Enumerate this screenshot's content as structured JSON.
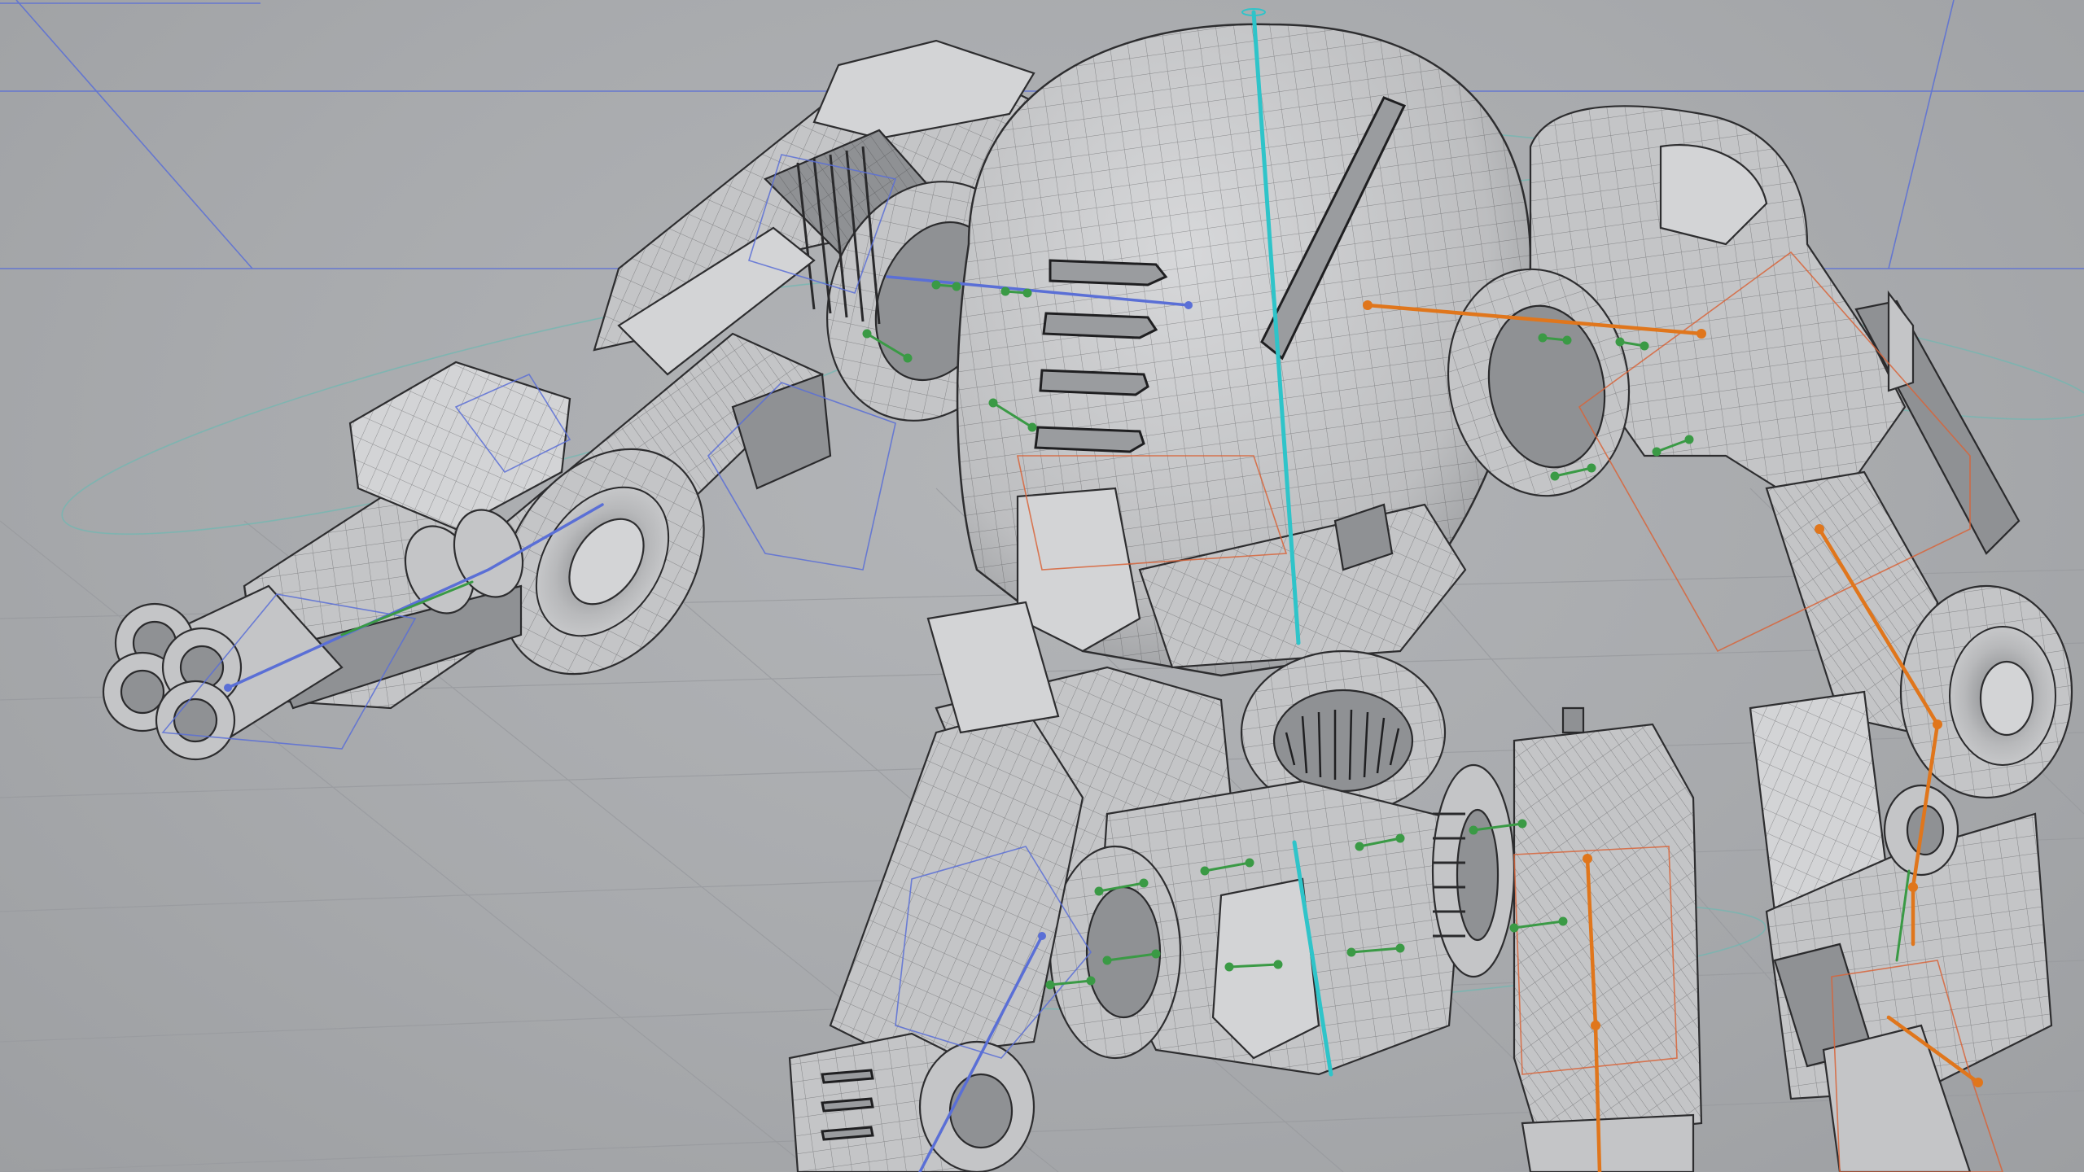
{
  "viewport": {
    "subject": "robot-mech-wireframe",
    "colors": {
      "background": "#a9abae",
      "mesh_fill": "#c4c5c7",
      "mesh_edge": "#2d2d2f",
      "grid": "#9a9ca0",
      "guide_blue": "#5a6fd6",
      "spine_cyan": "#2fc4c9",
      "bone_orange": "#e0761c",
      "rig_green": "#3a9a45",
      "control_teal": "#6fb8b2",
      "control_red": "#d8643a"
    }
  }
}
